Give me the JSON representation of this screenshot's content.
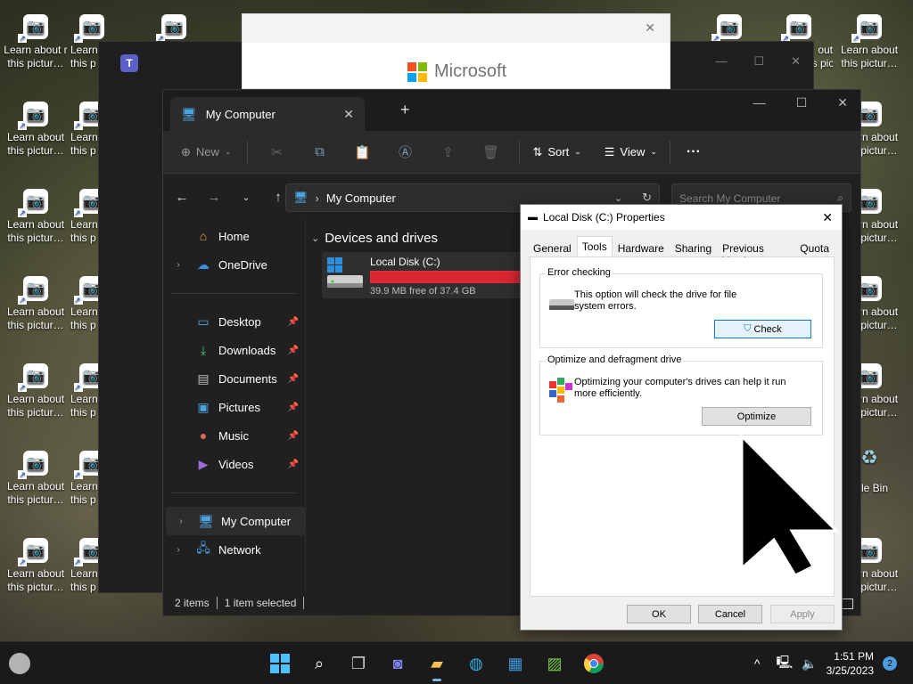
{
  "desktop": {
    "icon_label": "Learn about\nthis pictur…",
    "icon_label_first": "Learn about r\nthis pictur…",
    "icon_label_short": "Learn\nthis p",
    "right_icon_label": "Learn about\nthis pictur…",
    "right_icon_label_cut": "out\nthis pictur…",
    "recycle_label": "ycle Bin"
  },
  "ms_window": {
    "logo_text": "Microsoft"
  },
  "explorer": {
    "tab_title": "My Computer",
    "toolbar": {
      "new_label": "New",
      "sort_label": "Sort",
      "view_label": "View",
      "more_label": "···"
    },
    "address": "My Computer",
    "search_placeholder": "Search My Computer",
    "nav": [
      {
        "label": "Home"
      },
      {
        "label": "OneDrive"
      },
      {
        "label": "Desktop"
      },
      {
        "label": "Downloads"
      },
      {
        "label": "Documents"
      },
      {
        "label": "Pictures"
      },
      {
        "label": "Music"
      },
      {
        "label": "Videos"
      },
      {
        "label": "My Computer"
      },
      {
        "label": "Network"
      }
    ],
    "section_title": "Devices and drives",
    "drive": {
      "name": "Local Disk (C:)",
      "free_text": "39.9 MB free of 37.4 GB",
      "used_fraction": 0.999
    },
    "status": {
      "items": "2 items",
      "selected": "1 item selected"
    }
  },
  "properties": {
    "title": "Local Disk (C:) Properties",
    "tabs": [
      "General",
      "Tools",
      "Hardware",
      "Sharing",
      "Previous Versions",
      "Quota"
    ],
    "active_tab": "Tools",
    "error_checking": {
      "heading": "Error checking",
      "text": "This option will check the drive for file system errors.",
      "button": "Check"
    },
    "optimize": {
      "heading": "Optimize and defragment drive",
      "text": "Optimizing your computer's drives can help it run more efficiently.",
      "button": "Optimize"
    },
    "buttons": {
      "ok": "OK",
      "cancel": "Cancel",
      "apply": "Apply"
    }
  },
  "taskbar": {
    "time": "1:51 PM",
    "date": "3/25/2023",
    "notification_count": "2"
  },
  "colors": {
    "drive_bar": "#da2633",
    "accent": "#0078d7"
  }
}
